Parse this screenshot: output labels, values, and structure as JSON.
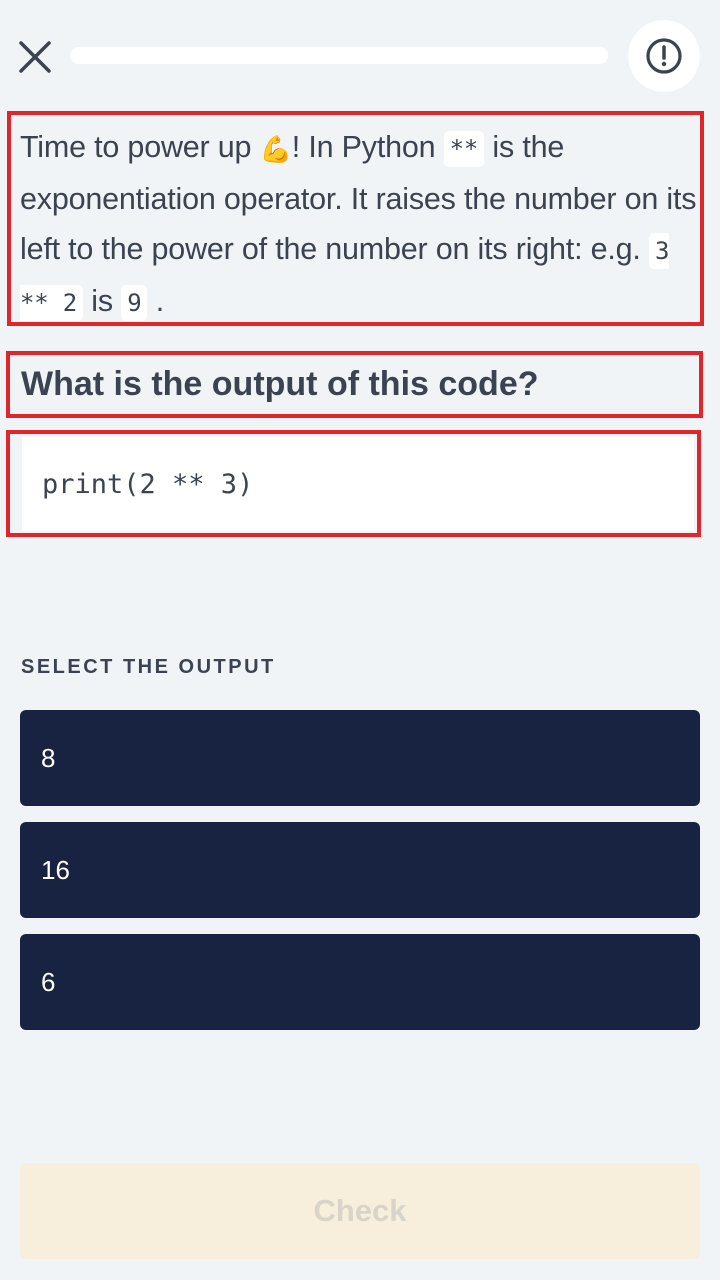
{
  "header": {
    "close_icon": "close-icon",
    "report_icon": "alert-circle-icon",
    "progress": 0
  },
  "intro": {
    "part1": "Time to power up ",
    "emoji": "💪",
    "part2": "! In Python ",
    "operator": "**",
    "part3": " is the exponentiation operator. It raises the number on its left to the power of the number on its right: e.g. ",
    "example_expr": "3 ** 2",
    "part4": " is ",
    "example_result": "9",
    "part5": " ."
  },
  "question": "What is the output of this code?",
  "code": "print(2 ** 3)",
  "select_label": "SELECT THE OUTPUT",
  "options": [
    "8",
    "16",
    "6"
  ],
  "check_label": "Check",
  "colors": {
    "highlight": "#e0262d",
    "option_bg": "#172340",
    "check_bg": "#f7efdc",
    "page_bg": "#f0f4f6"
  }
}
